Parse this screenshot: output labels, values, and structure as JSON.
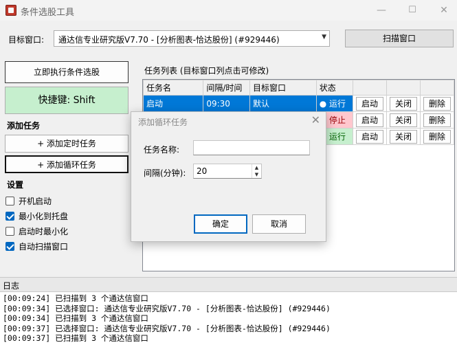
{
  "window": {
    "title": "条件选股工具"
  },
  "target": {
    "label": "目标窗口:",
    "selected": "通达信专业研究版V7.70 - [分析图表-恰达股份] (#929446)",
    "scan_button": "扫描窗口"
  },
  "left": {
    "run_button": "立即执行条件选股",
    "hotkey_button": "快捷键: Shift",
    "add_section": "添加任务",
    "add_timer_button": "+ 添加定时任务",
    "add_loop_button": "+ 添加循环任务",
    "settings_section": "设置",
    "settings": [
      {
        "label": "开机启动",
        "checked": false
      },
      {
        "label": "最小化到托盘",
        "checked": true
      },
      {
        "label": "启动时最小化",
        "checked": false
      },
      {
        "label": "自动扫描窗口",
        "checked": true
      }
    ]
  },
  "tasks": {
    "label": "任务列表 (目标窗口列点击可修改)",
    "columns": [
      "任务名",
      "间隔/时间",
      "目标窗口",
      "状态"
    ],
    "rows": [
      {
        "name": "启动",
        "time": "09:30",
        "target": "默认",
        "status": "● 运行",
        "state": "run",
        "btn_start": "启动",
        "btn_close": "关闭",
        "btn_delete": "删除"
      },
      {
        "name": "",
        "time": "",
        "target": "",
        "status": "● 停止",
        "state": "stop",
        "btn_start": "启动",
        "btn_close": "关闭",
        "btn_delete": "删除"
      },
      {
        "name": "",
        "time": "",
        "target": "",
        "status": "● 运行",
        "state": "run",
        "btn_start": "启动",
        "btn_close": "关闭",
        "btn_delete": "删除"
      }
    ]
  },
  "dialog": {
    "title": "添加循环任务",
    "name_label": "任务名称:",
    "name_value": "",
    "interval_label": "间隔(分钟):",
    "interval_value": "20",
    "ok_button": "确定",
    "cancel_button": "取消"
  },
  "log": {
    "header": "日志",
    "lines": [
      "[00:09:24] 已扫描到 3 个通达信窗口",
      "[00:09:34] 已选择窗口: 通达信专业研究版V7.70 - [分析图表-恰达股份] (#929446)",
      "[00:09:34] 已扫描到 3 个通达信窗口",
      "[00:09:37] 已选择窗口: 通达信专业研究版V7.70 - [分析图表-恰达股份] (#929446)",
      "[00:09:37] 已扫描到 3 个通达信窗口"
    ]
  },
  "colors": {
    "accent": "#0078d7",
    "hotkey_bg": "#c6efce",
    "run_bg": "#c6efce",
    "stop_bg": "#ffc7ce"
  }
}
